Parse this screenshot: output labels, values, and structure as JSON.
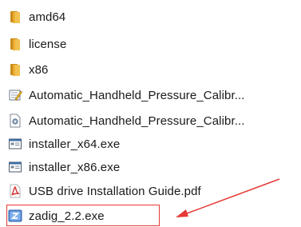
{
  "files": [
    {
      "name": "amd64",
      "icon": "folder-icon"
    },
    {
      "name": "license",
      "icon": "folder-icon"
    },
    {
      "name": "x86",
      "icon": "folder-icon"
    },
    {
      "name": "Automatic_Handheld_Pressure_Calibr...",
      "icon": "setup-info-icon"
    },
    {
      "name": "Automatic_Handheld_Pressure_Calibr...",
      "icon": "settings-file-icon"
    },
    {
      "name": "installer_x64.exe",
      "icon": "exe-icon"
    },
    {
      "name": "installer_x86.exe",
      "icon": "exe-icon"
    },
    {
      "name": "USB drive Installation Guide.pdf",
      "icon": "pdf-icon"
    },
    {
      "name": "zadig_2.2.exe",
      "icon": "zadig-app-icon"
    }
  ],
  "annotation": {
    "highlight_color": "#e53935",
    "target": "zadig_2.2.exe"
  }
}
